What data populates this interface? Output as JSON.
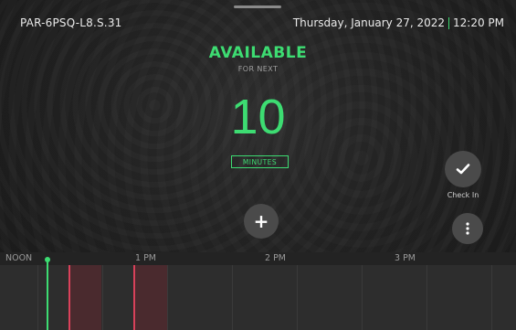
{
  "header": {
    "room_name": "PAR-6PSQ-L8.S.31",
    "date": "Thursday, January 27, 2022",
    "time": "12:20 PM"
  },
  "status": {
    "state": "AVAILABLE",
    "for_next": "FOR NEXT",
    "count": "10",
    "unit": "MINUTES"
  },
  "actions": {
    "add_icon": "plus-icon",
    "checkin_icon": "check-icon",
    "checkin_label": "Check In",
    "more_icon": "more-vertical-icon"
  },
  "timeline": {
    "labels": [
      "NOON",
      "1 PM",
      "2 PM",
      "3 PM"
    ]
  },
  "colors": {
    "accent": "#3ddc72",
    "busy": "#d9415a"
  }
}
